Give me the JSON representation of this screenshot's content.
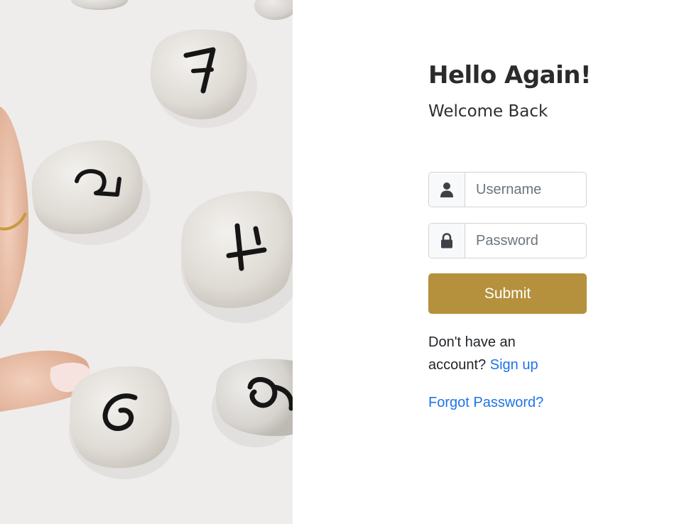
{
  "hero": {
    "image_description_icon": "numbered-pebbles-image"
  },
  "login": {
    "title": "Hello Again!",
    "subtitle": "Welcome Back",
    "username_placeholder": "Username",
    "password_placeholder": "Password",
    "username_icon": "user-icon",
    "password_icon": "lock-icon",
    "submit_label": "Submit",
    "no_account_text": "Don't have an account?",
    "signup_link": "Sign up",
    "forgot_link": "Forgot Password?"
  },
  "colors": {
    "accent": "#b5913d",
    "link": "#1f73e8",
    "text": "#2b2b2b"
  }
}
